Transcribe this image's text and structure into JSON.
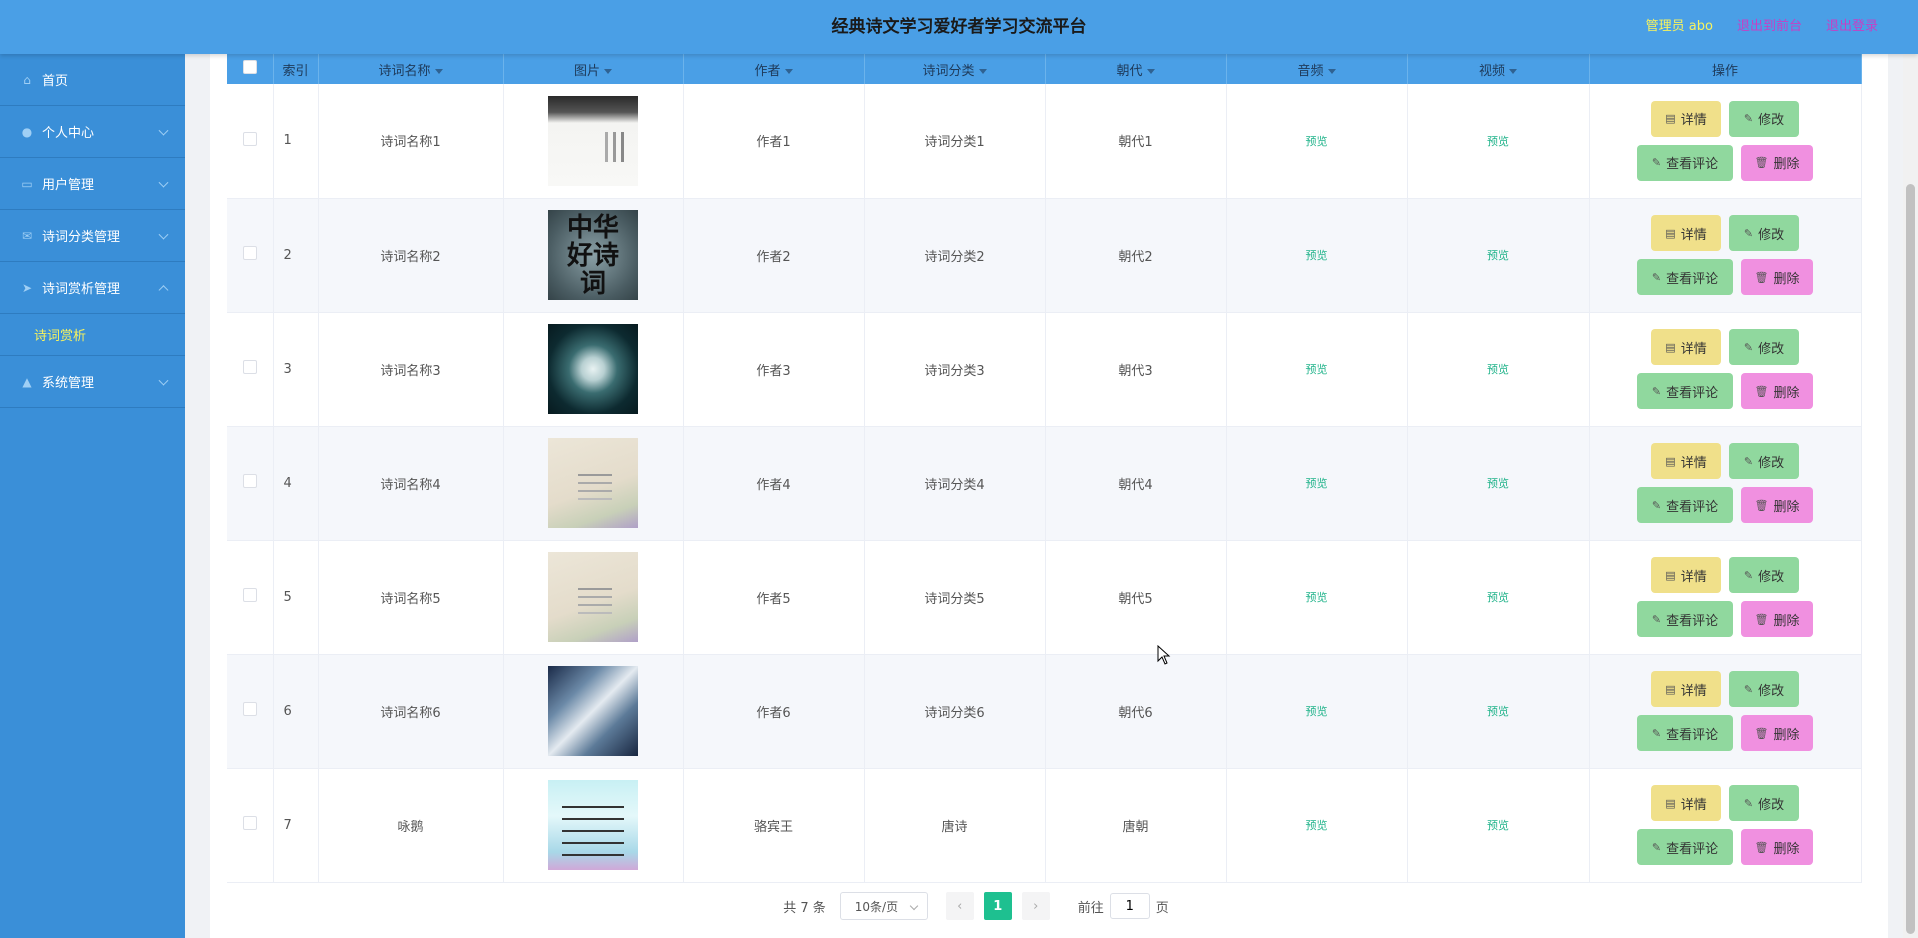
{
  "header": {
    "title": "经典诗文学习爱好者学习交流平台",
    "user": "管理员 abo",
    "back_front": "退出到前台",
    "logout": "退出登录"
  },
  "sidebar": {
    "items": [
      {
        "label": "首页",
        "icon": "home-icon"
      },
      {
        "label": "个人中心",
        "icon": "user-icon"
      },
      {
        "label": "用户管理",
        "icon": "message-icon"
      },
      {
        "label": "诗词分类管理",
        "icon": "mail-icon"
      },
      {
        "label": "诗词赏析管理",
        "icon": "send-icon"
      },
      {
        "label": "系统管理",
        "icon": "thumb-icon"
      }
    ],
    "sub_item": "诗词赏析"
  },
  "table": {
    "headers": [
      "索引",
      "诗词名称",
      "图片",
      "作者",
      "诗词分类",
      "朝代",
      "音频",
      "视频",
      "操作"
    ],
    "preview_label": "预览",
    "buttons": {
      "detail": "详情",
      "edit": "修改",
      "comment": "查看评论",
      "delete": "删除"
    },
    "rows": [
      {
        "index": "1",
        "name": "诗词名称1",
        "author": "作者1",
        "category": "诗词分类1",
        "dynasty": "朝代1"
      },
      {
        "index": "2",
        "name": "诗词名称2",
        "author": "作者2",
        "category": "诗词分类2",
        "dynasty": "朝代2"
      },
      {
        "index": "3",
        "name": "诗词名称3",
        "author": "作者3",
        "category": "诗词分类3",
        "dynasty": "朝代3"
      },
      {
        "index": "4",
        "name": "诗词名称4",
        "author": "作者4",
        "category": "诗词分类4",
        "dynasty": "朝代4"
      },
      {
        "index": "5",
        "name": "诗词名称5",
        "author": "作者5",
        "category": "诗词分类5",
        "dynasty": "朝代5"
      },
      {
        "index": "6",
        "name": "诗词名称6",
        "author": "作者6",
        "category": "诗词分类6",
        "dynasty": "朝代6"
      },
      {
        "index": "7",
        "name": "咏鹅",
        "author": "骆宾王",
        "category": "唐诗",
        "dynasty": "唐朝"
      }
    ]
  },
  "pager": {
    "total": "共 7 条",
    "page_size": "10条/页",
    "current": "1",
    "goto_prefix": "前往",
    "goto_value": "1",
    "goto_suffix": "页"
  }
}
